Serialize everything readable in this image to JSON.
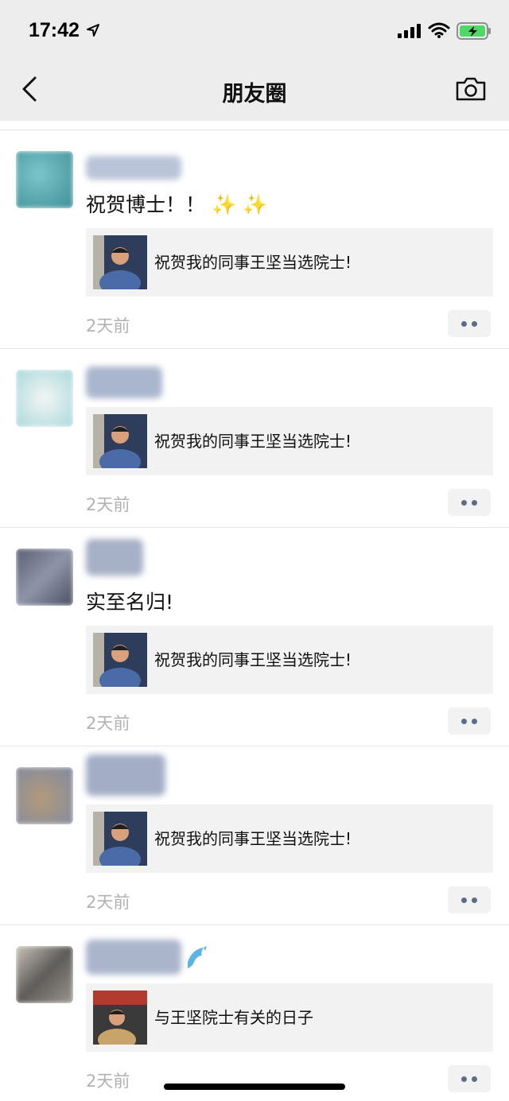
{
  "status_bar": {
    "time": "17:42"
  },
  "nav": {
    "title": "朋友圈"
  },
  "posts": [
    {
      "text": "祝贺博士！！ ✨ ✨",
      "link_title": "祝贺我的同事王坚当选院士!",
      "time": "2天前",
      "avatar_color": "#6fb7c0"
    },
    {
      "text": "",
      "link_title": "祝贺我的同事王坚当选院士!",
      "time": "2天前",
      "avatar_color": "#cfe3e6"
    },
    {
      "text": "实至名归!",
      "link_title": "祝贺我的同事王坚当选院士!",
      "time": "2天前",
      "avatar_color": "#6b6f80"
    },
    {
      "text": "",
      "link_title": "祝贺我的同事王坚当选院士!",
      "time": "2天前",
      "avatar_color": "#a38d72"
    },
    {
      "text": "",
      "link_title": "与王坚院士有关的日子",
      "time": "2天前",
      "avatar_color": "#7d7b78"
    }
  ]
}
